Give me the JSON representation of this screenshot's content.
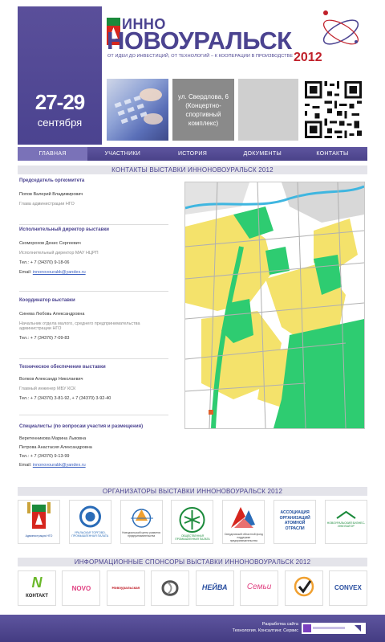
{
  "header": {
    "logo_inno": "ИННО",
    "logo_main": "НОВОУРАЛЬСК",
    "logo_year": "2012",
    "slogan": "ОТ ИДЕИ ДО ИНВЕСТИЦИЙ, ОТ ТЕХНОЛОГИЙ – К КООПЕРАЦИИ В ПРОИЗВОДСТВЕ",
    "date_days": "27-29",
    "date_month": "сентября",
    "address_lines": [
      "ул. Свердлова, 6",
      "(Концертно-",
      "спортивный",
      "комплекс)"
    ]
  },
  "nav": {
    "items": [
      {
        "label": "ГЛАВНАЯ",
        "active": true
      },
      {
        "label": "УЧАСТНИКИ",
        "active": false
      },
      {
        "label": "ИСТОРИЯ",
        "active": false
      },
      {
        "label": "ДОКУМЕНТЫ",
        "active": false
      },
      {
        "label": "КОНТАКТЫ",
        "active": false
      }
    ]
  },
  "contacts_section": {
    "title": "КОНТАКТЫ ВЫСТАВКИ ИННОНОВОУРАЛЬСК 2012",
    "blocks": [
      {
        "role": "Председатель оргкомитета",
        "name": "Попов Валерий Владимирович",
        "position": "Глава администрации НГО"
      },
      {
        "role": "Исполнительный директор выставки",
        "name": "Скоморохов Денис Сергеевич",
        "position": "Исполнительный директор МАУ НЦРП",
        "phone": "Тел.: + 7 (34370) 9-18-06",
        "email_label": "Email:",
        "email": "innonovourabk@yandex.ru"
      },
      {
        "role": "Координатор выставки",
        "name": "Синева Любовь Александровна",
        "position_lines": [
          "Начальник отдела малого, среднего предпринимательства",
          "администрации НГО"
        ],
        "phone": "Тел.: + 7 (34370) 7-09-83"
      },
      {
        "role": "Техническое обеспечение выставки",
        "name": "Волков Александр Николаевич",
        "position": "Главный инженер МБУ КСК",
        "phone": "Тел.: + 7 (34370) 3-81-92, + 7 (34370) 3-92-40"
      },
      {
        "role": "Специалисты (по вопросам участия и размещения)",
        "names": [
          "Веретенникова Марина Львовна",
          "Петрова Анастасия Александровна"
        ],
        "phone": "Тел.: + 7 (34370) 9-13-99",
        "email_label": "Email:",
        "email": "innonovourabk@yandex.ru"
      }
    ]
  },
  "organizers": {
    "title": "ОРГАНИЗАТОРЫ ВЫСТАВКИ ИННОНОВОУРАЛЬСК 2012",
    "logos": [
      {
        "name": "organizer-admin-ngo",
        "caption": "Администрация НГО"
      },
      {
        "name": "organizer-2",
        "caption": "УРАЛЬСКАЯ ТОРГОВО-ПРОМЫШЛЕННАЯ ПАЛАТА"
      },
      {
        "name": "organizer-3",
        "caption": "Новоуральский центр развития предпринимательства"
      },
      {
        "name": "organizer-4",
        "caption": "ОБЩЕСТВЕННАЯ ПРОМЫШЛЕННАЯ ПАЛАТА"
      },
      {
        "name": "organizer-5",
        "caption": "Свердловский областной фонд поддержки предпринимательства"
      },
      {
        "name": "organizer-6",
        "caption": "АССОЦИАЦИЯ ОРГАНИЗАЦИЙ АТОМНОЙ ОТРАСЛИ"
      },
      {
        "name": "organizer-7",
        "caption": "НОВОУРАЛЬСКИЙ БИЗНЕС-ИНКУБАТОР"
      }
    ]
  },
  "sponsors": {
    "title": "ИНФОРМАЦИОННЫЕ СПОНСОРЫ ВЫСТАВКИ ИННОНОВОУРАЛЬСК 2012",
    "logos": [
      {
        "name": "sponsor-kontakt",
        "text": "КОНТАКТ",
        "mark": "N"
      },
      {
        "name": "sponsor-novo",
        "text": "NOVO"
      },
      {
        "name": "sponsor-novouralskaya",
        "text": "Новоуральская"
      },
      {
        "name": "sponsor-4",
        "text": ""
      },
      {
        "name": "sponsor-neiva",
        "text": "НЕЙВА"
      },
      {
        "name": "sponsor-semya",
        "text": "Семьи"
      },
      {
        "name": "sponsor-7",
        "text": ""
      },
      {
        "name": "sponsor-convex",
        "text": "CONVEX"
      }
    ]
  },
  "footer": {
    "credit_line1": "Разработка сайта",
    "credit_line2": "Технология. Консалтинг. Сервис"
  },
  "colors": {
    "brand_purple": "#4b4390",
    "accent_red": "#c0202a",
    "link_blue": "#3a5fc0",
    "map_green": "#2ecc71",
    "map_yellow": "#f4e26b"
  }
}
